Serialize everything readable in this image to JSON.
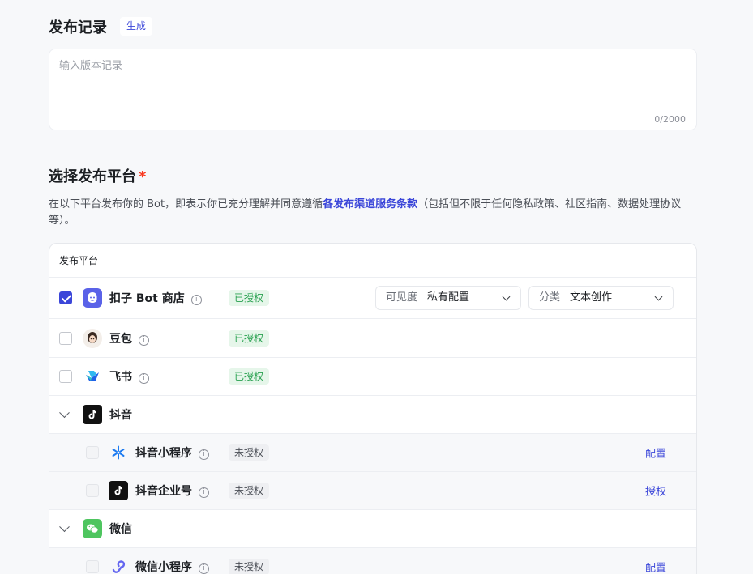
{
  "release_notes": {
    "title": "发布记录",
    "generate_label": "生成",
    "placeholder": "输入版本记录",
    "value": "",
    "counter": "0/2000"
  },
  "platform_select": {
    "title": "选择发布平台",
    "required_mark": "*",
    "desc_prefix": "在以下平台发布你的 Bot，即表示你已充分理解并同意遵循",
    "desc_link": "各发布渠道服务条款",
    "desc_suffix": "（包括但不限于任何隐私政策、社区指南、数据处理协议等）。"
  },
  "table": {
    "header": "发布平台",
    "rows": [
      {
        "name": "扣子 Bot 商店",
        "icon": "coze-store-icon",
        "checked": true,
        "status": "已授权",
        "visibility_label": "可见度",
        "visibility_value": "私有配置",
        "category_label": "分类",
        "category_value": "文本创作"
      },
      {
        "name": "豆包",
        "icon": "doubao-icon",
        "checked": false,
        "status": "已授权"
      },
      {
        "name": "飞书",
        "icon": "feishu-icon",
        "checked": false,
        "status": "已授权"
      },
      {
        "name": "抖音",
        "icon": "douyin-icon",
        "group": true,
        "expanded": true
      },
      {
        "name": "抖音小程序",
        "icon": "douyin-miniapp-icon",
        "status": "未授权",
        "action": "配置"
      },
      {
        "name": "抖音企业号",
        "icon": "douyin-enterprise-icon",
        "status": "未授权",
        "action": "授权"
      },
      {
        "name": "微信",
        "icon": "wechat-icon",
        "group": true,
        "expanded": true
      },
      {
        "name": "微信小程序",
        "icon": "wechat-miniapp-icon",
        "status": "未授权",
        "action": "配置"
      }
    ]
  },
  "colors": {
    "accent": "#3b46d9",
    "authorized": "#29a150",
    "required": "#f93920"
  }
}
